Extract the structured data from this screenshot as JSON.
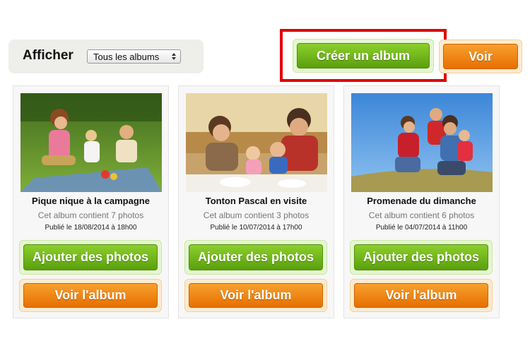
{
  "filter": {
    "label": "Afficher",
    "selected": "Tous les albums"
  },
  "toolbar": {
    "create_label": "Créer un album",
    "view_label": "Voir"
  },
  "albums": [
    {
      "title": "Pique nique à la campagne",
      "count": "Cet album contient 7 photos",
      "date": "Publié le 18/08/2014 à 18h00",
      "add_label": "Ajouter des photos",
      "view_label": "Voir l'album"
    },
    {
      "title": "Tonton Pascal en visite",
      "count": "Cet album contient 3 photos",
      "date": "Publié le 10/07/2014 à 17h00",
      "add_label": "Ajouter des photos",
      "view_label": "Voir l'album"
    },
    {
      "title": "Promenade du dimanche",
      "count": "Cet album contient 6 photos",
      "date": "Publié le 04/07/2014 à 11h00",
      "add_label": "Ajouter des photos",
      "view_label": "Voir l'album"
    }
  ],
  "colors": {
    "green_button": "#6cb41a",
    "orange_button": "#ef8a10",
    "highlight": "#e00000"
  }
}
